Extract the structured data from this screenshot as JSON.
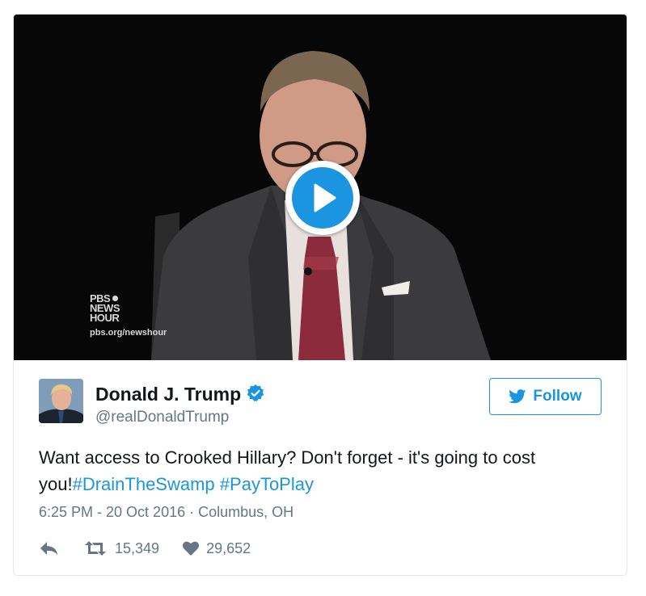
{
  "media": {
    "watermark": {
      "line1": "PBS",
      "line2": "NEWS",
      "line3": "HOUR",
      "url": "pbs.org/newshour"
    },
    "play_icon": "play-icon"
  },
  "author": {
    "name": "Donald J. Trump",
    "handle": "@realDonaldTrump",
    "verified_icon": "verified-badge-icon"
  },
  "follow": {
    "label": "Follow",
    "icon": "twitter-bird-icon"
  },
  "tweet": {
    "text": "Want access to Crooked Hillary? Don't forget - it's going to cost you!",
    "hashtags": [
      "#DrainTheSwamp",
      "#PayToPlay"
    ],
    "time": "6:25 PM - 20 Oct 2016",
    "separator": "·",
    "location": "Columbus, OH"
  },
  "stats": {
    "retweets": "15,349",
    "likes": "29,652"
  },
  "colors": {
    "accent": "#1b95e0",
    "secondary_text": "#657786",
    "border": "#e1e8ed"
  }
}
